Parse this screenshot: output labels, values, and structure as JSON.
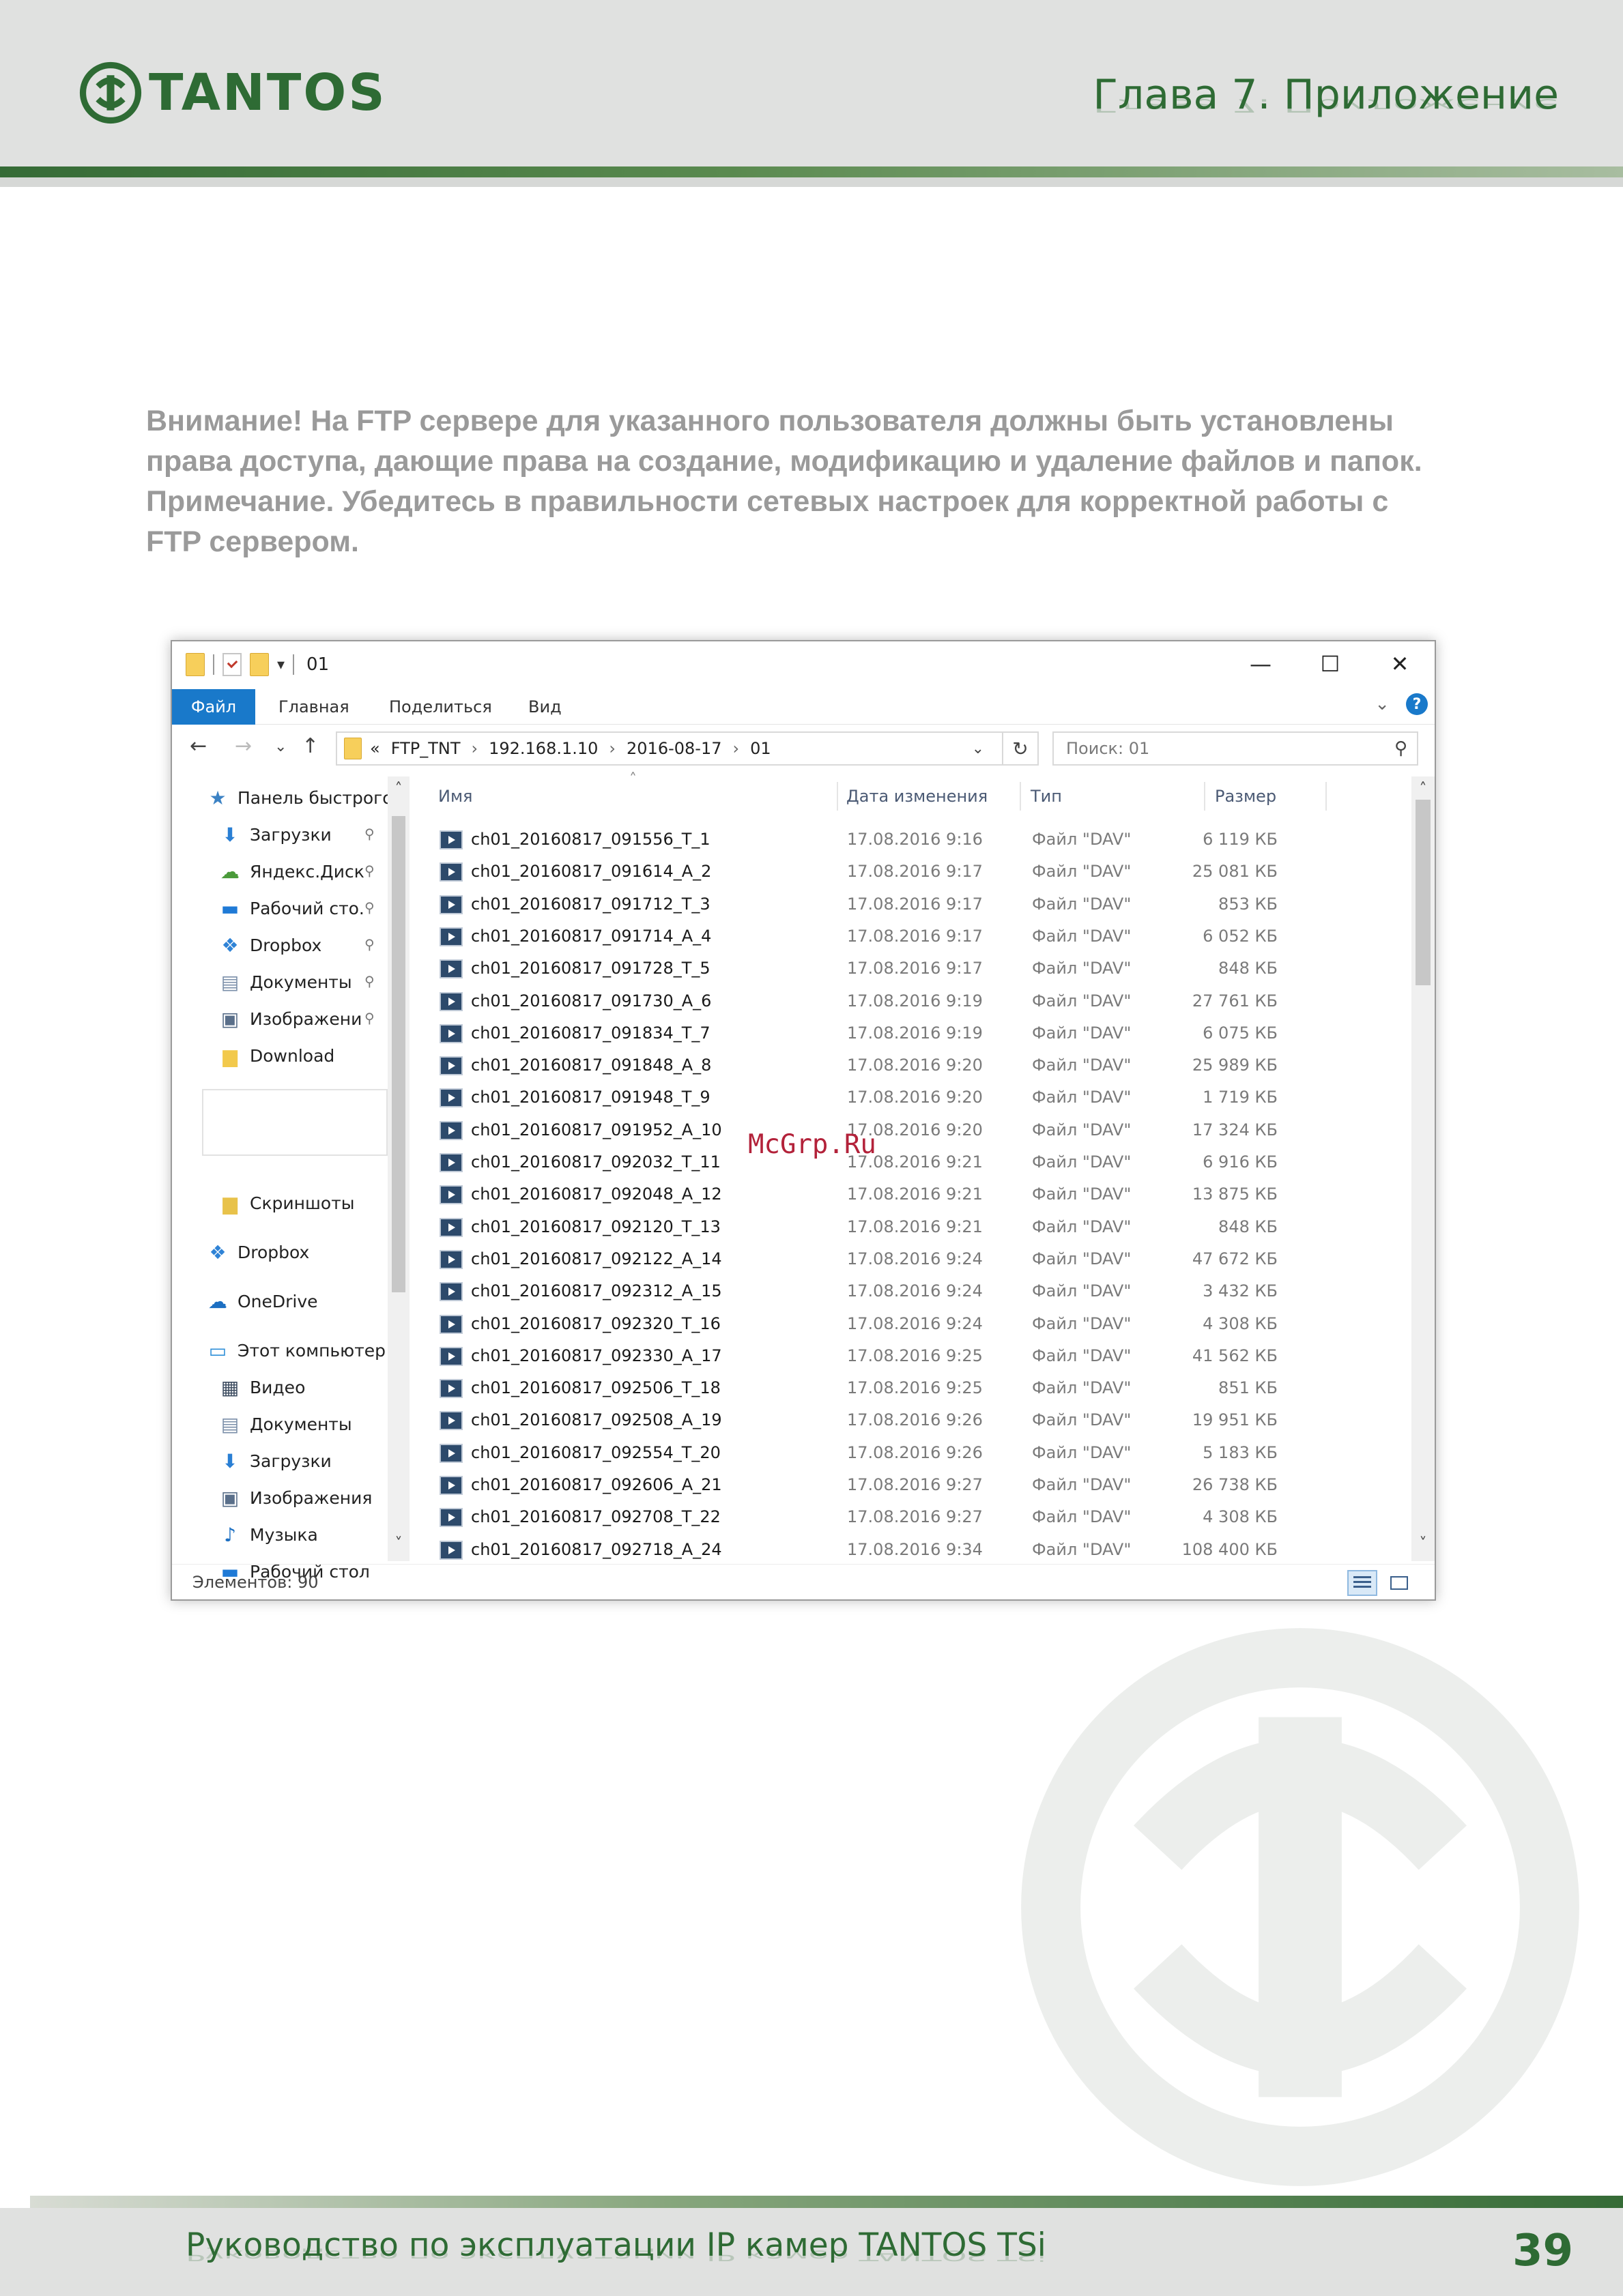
{
  "header": {
    "logo_text": "TANTOS",
    "chapter": "Глава 7. Приложение"
  },
  "notice": {
    "lines": [
      "Внимание! На FTP сервере для указанного пользователя должны быть установлены",
      "права доступа, дающие права на создание, модификацию и удаление файлов и папок.",
      "Примечание. Убедитесь в правильности сетевых настроек для корректной работы с",
      "FTP сервером."
    ]
  },
  "explorer": {
    "title": "01",
    "window_buttons": {
      "minimize": "—",
      "maximize": "☐",
      "close": "✕"
    },
    "menu": {
      "file": "Файл",
      "home": "Главная",
      "share": "Поделиться",
      "view": "Вид"
    },
    "address": {
      "prefix": "«",
      "segments": [
        "FTP_TNT",
        "192.168.1.10",
        "2016-08-17",
        "01"
      ]
    },
    "search_placeholder": "Поиск: 01",
    "nav_items": [
      {
        "label": "Панель быстрого",
        "icon": "star-icon",
        "pinned": false,
        "indent": false
      },
      {
        "label": "Загрузки",
        "icon": "download-arrow-icon",
        "pinned": true,
        "indent": true
      },
      {
        "label": "Яндекс.Диск",
        "icon": "yandex-disk-icon",
        "pinned": true,
        "indent": true
      },
      {
        "label": "Рабочий сто.",
        "icon": "desktop-icon",
        "pinned": true,
        "indent": true
      },
      {
        "label": "Dropbox",
        "icon": "dropbox-icon",
        "pinned": true,
        "indent": true
      },
      {
        "label": "Документы",
        "icon": "document-icon",
        "pinned": true,
        "indent": true
      },
      {
        "label": "Изображени",
        "icon": "pictures-icon",
        "pinned": true,
        "indent": true
      },
      {
        "label": "Download",
        "icon": "folder-icon",
        "pinned": false,
        "indent": true
      },
      {
        "label": "Скриншоты",
        "icon": "folder-sync-icon",
        "pinned": false,
        "indent": true
      },
      {
        "label": "Dropbox",
        "icon": "dropbox-icon",
        "pinned": false,
        "indent": false
      },
      {
        "label": "OneDrive",
        "icon": "cloud-icon",
        "pinned": false,
        "indent": false
      },
      {
        "label": "Этот компьютер",
        "icon": "computer-icon",
        "pinned": false,
        "indent": false
      },
      {
        "label": "Видео",
        "icon": "video-icon",
        "pinned": false,
        "indent": true
      },
      {
        "label": "Документы",
        "icon": "document-icon",
        "pinned": false,
        "indent": true
      },
      {
        "label": "Загрузки",
        "icon": "download-arrow-icon",
        "pinned": false,
        "indent": true
      },
      {
        "label": "Изображения",
        "icon": "pictures-icon",
        "pinned": false,
        "indent": true
      },
      {
        "label": "Музыка",
        "icon": "music-icon",
        "pinned": false,
        "indent": true
      },
      {
        "label": "Рабочий стол",
        "icon": "desktop-icon",
        "pinned": false,
        "indent": true
      }
    ],
    "columns": {
      "name": "Имя",
      "date": "Дата изменения",
      "type": "Тип",
      "size": "Размер"
    },
    "files": [
      {
        "name": "ch01_20160817_091556_T_1",
        "date": "17.08.2016 9:16",
        "type": "Файл \"DAV\"",
        "size": "6 119 КБ"
      },
      {
        "name": "ch01_20160817_091614_A_2",
        "date": "17.08.2016 9:17",
        "type": "Файл \"DAV\"",
        "size": "25 081 КБ"
      },
      {
        "name": "ch01_20160817_091712_T_3",
        "date": "17.08.2016 9:17",
        "type": "Файл \"DAV\"",
        "size": "853 КБ"
      },
      {
        "name": "ch01_20160817_091714_A_4",
        "date": "17.08.2016 9:17",
        "type": "Файл \"DAV\"",
        "size": "6 052 КБ"
      },
      {
        "name": "ch01_20160817_091728_T_5",
        "date": "17.08.2016 9:17",
        "type": "Файл \"DAV\"",
        "size": "848 КБ"
      },
      {
        "name": "ch01_20160817_091730_A_6",
        "date": "17.08.2016 9:19",
        "type": "Файл \"DAV\"",
        "size": "27 761 КБ"
      },
      {
        "name": "ch01_20160817_091834_T_7",
        "date": "17.08.2016 9:19",
        "type": "Файл \"DAV\"",
        "size": "6 075 КБ"
      },
      {
        "name": "ch01_20160817_091848_A_8",
        "date": "17.08.2016 9:20",
        "type": "Файл \"DAV\"",
        "size": "25 989 КБ"
      },
      {
        "name": "ch01_20160817_091948_T_9",
        "date": "17.08.2016 9:20",
        "type": "Файл \"DAV\"",
        "size": "1 719 КБ"
      },
      {
        "name": "ch01_20160817_091952_A_10",
        "date": "17.08.2016 9:20",
        "type": "Файл \"DAV\"",
        "size": "17 324 КБ"
      },
      {
        "name": "ch01_20160817_092032_T_11",
        "date": "17.08.2016 9:21",
        "type": "Файл \"DAV\"",
        "size": "6 916 КБ"
      },
      {
        "name": "ch01_20160817_092048_A_12",
        "date": "17.08.2016 9:21",
        "type": "Файл \"DAV\"",
        "size": "13 875 КБ"
      },
      {
        "name": "ch01_20160817_092120_T_13",
        "date": "17.08.2016 9:21",
        "type": "Файл \"DAV\"",
        "size": "848 КБ"
      },
      {
        "name": "ch01_20160817_092122_A_14",
        "date": "17.08.2016 9:24",
        "type": "Файл \"DAV\"",
        "size": "47 672 КБ"
      },
      {
        "name": "ch01_20160817_092312_A_15",
        "date": "17.08.2016 9:24",
        "type": "Файл \"DAV\"",
        "size": "3 432 КБ"
      },
      {
        "name": "ch01_20160817_092320_T_16",
        "date": "17.08.2016 9:24",
        "type": "Файл \"DAV\"",
        "size": "4 308 КБ"
      },
      {
        "name": "ch01_20160817_092330_A_17",
        "date": "17.08.2016 9:25",
        "type": "Файл \"DAV\"",
        "size": "41 562 КБ"
      },
      {
        "name": "ch01_20160817_092506_T_18",
        "date": "17.08.2016 9:25",
        "type": "Файл \"DAV\"",
        "size": "851 КБ"
      },
      {
        "name": "ch01_20160817_092508_A_19",
        "date": "17.08.2016 9:26",
        "type": "Файл \"DAV\"",
        "size": "19 951 КБ"
      },
      {
        "name": "ch01_20160817_092554_T_20",
        "date": "17.08.2016 9:26",
        "type": "Файл \"DAV\"",
        "size": "5 183 КБ"
      },
      {
        "name": "ch01_20160817_092606_A_21",
        "date": "17.08.2016 9:27",
        "type": "Файл \"DAV\"",
        "size": "26 738 КБ"
      },
      {
        "name": "ch01_20160817_092708_T_22",
        "date": "17.08.2016 9:27",
        "type": "Файл \"DAV\"",
        "size": "4 308 КБ"
      },
      {
        "name": "ch01_20160817_092718_A_24",
        "date": "17.08.2016 9:34",
        "type": "Файл \"DAV\"",
        "size": "108 400 КБ"
      }
    ],
    "status": "Элементов: 90"
  },
  "watermark": "McGrp.Ru",
  "footer": {
    "title": "Руководство по эксплуатации IP камер TANTOS TSi",
    "page": "39"
  },
  "colors": {
    "brand_green": "#2e6b34",
    "accent_blue": "#1979ca",
    "notice_gray": "#9a9a9a"
  }
}
